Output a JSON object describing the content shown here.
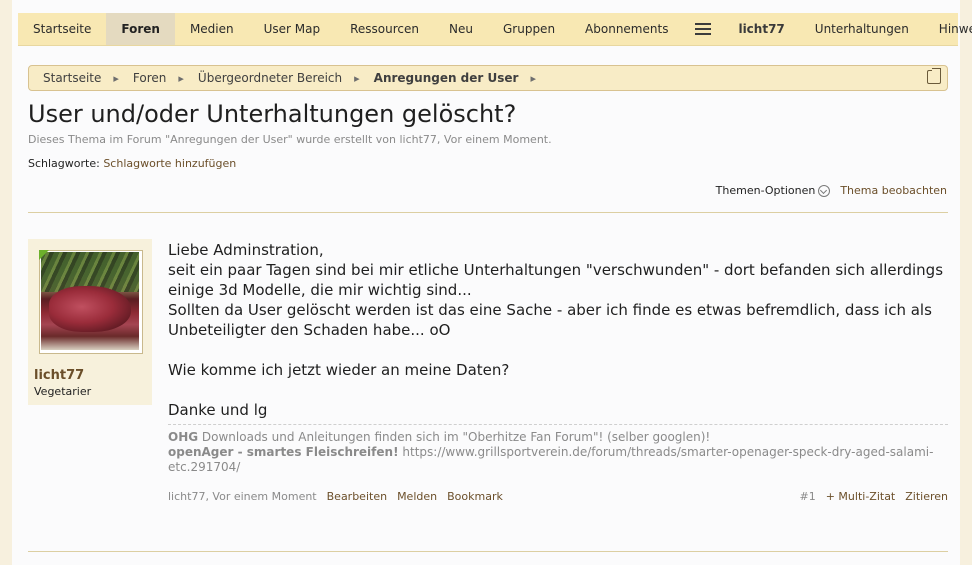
{
  "nav": {
    "tabs": [
      {
        "label": "Startseite"
      },
      {
        "label": "Foren"
      },
      {
        "label": "Medien"
      },
      {
        "label": "User Map"
      },
      {
        "label": "Ressourcen"
      },
      {
        "label": "Neu"
      },
      {
        "label": "Gruppen"
      },
      {
        "label": "Abonnements"
      }
    ],
    "user": "licht77",
    "conversations": "Unterhaltungen",
    "alerts": "Hinweise",
    "menu_icon": "hamburger-icon",
    "active_tab": "Foren"
  },
  "breadcrumb": {
    "items": [
      "Startseite",
      "Foren",
      "Übergeordneter Bereich",
      "Anregungen der User"
    ],
    "jump_icon": "external-link-icon"
  },
  "thread": {
    "title": "User und/oder Unterhaltungen gelöscht?",
    "description": "Dieses Thema im Forum \"Anregungen der User\" wurde erstellt von licht77, Vor einem Moment.",
    "tags_label": "Schlagworte:",
    "tags_link": "Schlagworte hinzufügen",
    "options_label": "Themen-Optionen",
    "watch_label": "Thema beobachten"
  },
  "post": {
    "author": "licht77",
    "user_title": "Vegetarier",
    "lines": [
      "Liebe Adminstration,",
      "seit ein paar Tagen sind bei mir etliche Unterhaltungen \"verschwunden\" - dort befanden sich allerdings einige 3d Modelle, die mir wichtig sind...",
      "Sollten da User gelöscht werden ist das eine Sache - aber ich finde es etwas befremdlich, dass ich als Unbeteiligter den Schaden habe... oO",
      "Wie komme ich jetzt wieder an meine Daten?",
      "Danke und lg"
    ],
    "signature": {
      "line1_bold": "OHG",
      "line1_rest": " Downloads und Anleitungen finden sich im \"Oberhitze Fan Forum\"! (selber googlen)!",
      "line2_bold": "openAger - smartes Fleischreifen!",
      "line2_url": "https://www.grillsportverein.de/forum/threads/smarter-openager-speck-dry-aged-salami-etc.291704/"
    },
    "meta": {
      "author_time": "licht77, Vor einem Moment",
      "edit": "Bearbeiten",
      "report": "Melden",
      "bookmark": "Bookmark",
      "number": "#1",
      "multiquote": "+ Multi-Zitat",
      "quote": "Zitieren"
    }
  },
  "colors": {
    "navbar_bg": "#f8e8b3",
    "breadcrumb_bg": "#f8ecc6",
    "link": "#6b4f2a",
    "page_bg": "#fbfbfc",
    "frame_bg": "#f5efdd"
  }
}
